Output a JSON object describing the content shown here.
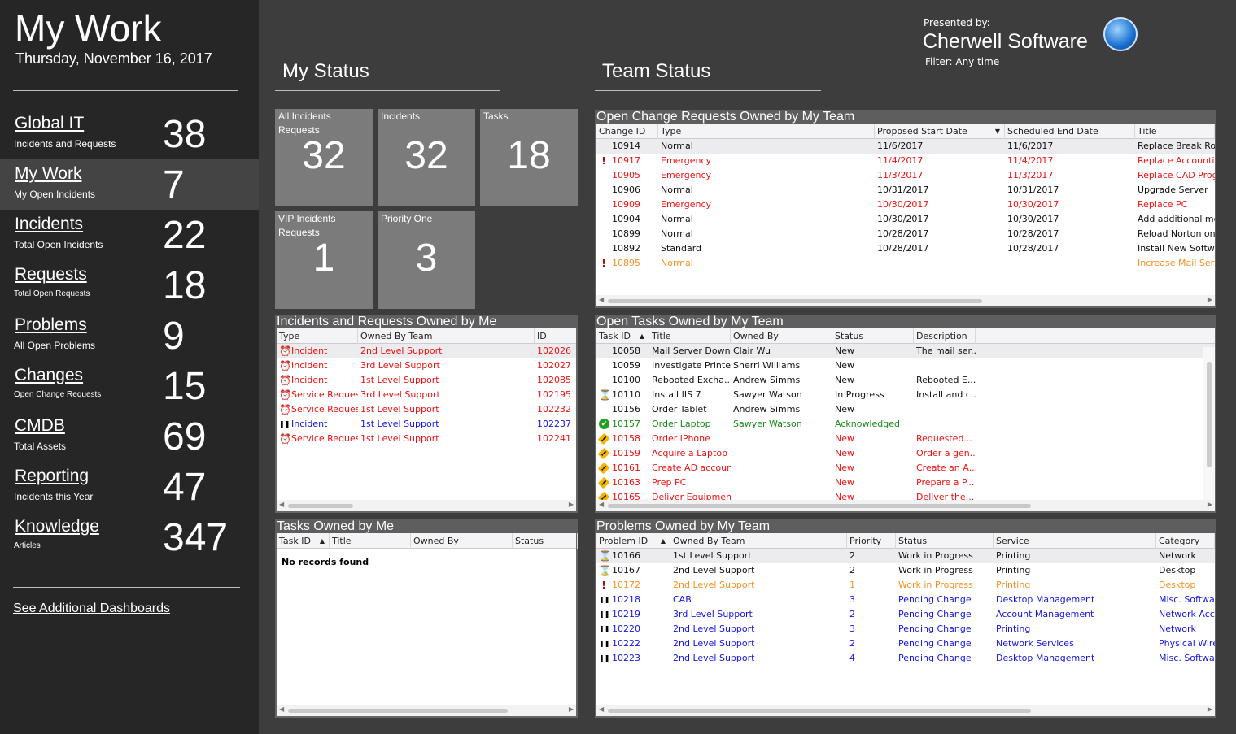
{
  "app": {
    "title": "My Work",
    "date": "Thursday, November 16, 2017"
  },
  "sidebar": {
    "items": [
      {
        "label": "Global IT",
        "sub": "Incidents and Requests",
        "count": "38"
      },
      {
        "label": "My Work",
        "sub": "My Open Incidents",
        "count": "7",
        "active": true
      },
      {
        "label": "Incidents",
        "sub": "Total Open Incidents",
        "count": "22"
      },
      {
        "label": "Requests",
        "sub": "Total Open Requests",
        "count": "18"
      },
      {
        "label": "Problems",
        "sub": "All Open Problems",
        "count": "9"
      },
      {
        "label": "Changes",
        "sub": "Open Change Requests",
        "count": "15"
      },
      {
        "label": "CMDB",
        "sub": "Total Assets",
        "count": "69"
      },
      {
        "label": "Reporting",
        "sub": "Incidents this Year",
        "count": "47"
      },
      {
        "label": "Knowledge",
        "sub": "Articles",
        "count": "347"
      }
    ],
    "see_more": "See Additional Dashboards"
  },
  "header": {
    "presented_by": "Presented by:",
    "company": "Cherwell Software",
    "filter": "Filter: Any time"
  },
  "my_status": {
    "title": "My Status",
    "tiles": [
      {
        "label": "All Incidents Requests",
        "value": "32"
      },
      {
        "label": "Incidents",
        "value": "32"
      },
      {
        "label": "Tasks",
        "value": "18"
      },
      {
        "label": "VIP Incidents Requests",
        "value": "1"
      },
      {
        "label": "Priority One",
        "value": "3"
      }
    ]
  },
  "team_status": {
    "title": "Team Status"
  },
  "colors": {
    "red": "#ee1111",
    "orange": "#f7901e",
    "blue": "#1414e6",
    "green": "#168a16",
    "black": "#111111"
  },
  "panels": {
    "change_requests": {
      "title": "Open Change Requests Owned by My Team",
      "columns": [
        "Change ID",
        "Type",
        "Proposed Start Date",
        "Scheduled End Date",
        "Title"
      ],
      "rows": [
        {
          "c": "black",
          "cells": [
            "10914",
            "Normal",
            "11/6/2017",
            "11/6/2017",
            "Replace Break Room"
          ]
        },
        {
          "c": "red",
          "i": "exclaim",
          "cells": [
            "10917",
            "Emergency",
            "11/4/2017",
            "11/4/2017",
            "Replace Accounting"
          ]
        },
        {
          "c": "red",
          "cells": [
            "10905",
            "Emergency",
            "11/3/2017",
            "11/3/2017",
            "Replace CAD Program"
          ]
        },
        {
          "c": "black",
          "cells": [
            "10906",
            "Normal",
            "10/31/2017",
            "10/31/2017",
            "Upgrade Server"
          ]
        },
        {
          "c": "red",
          "cells": [
            "10909",
            "Emergency",
            "10/30/2017",
            "10/30/2017",
            "Replace PC"
          ]
        },
        {
          "c": "black",
          "cells": [
            "10904",
            "Normal",
            "10/30/2017",
            "10/30/2017",
            "Add additional memory"
          ]
        },
        {
          "c": "black",
          "cells": [
            "10899",
            "Normal",
            "10/28/2017",
            "10/28/2017",
            "Reload Norton on Server"
          ]
        },
        {
          "c": "black",
          "cells": [
            "10892",
            "Standard",
            "10/28/2017",
            "10/28/2017",
            "Install New Software"
          ]
        },
        {
          "c": "orange",
          "i": "exclaim",
          "cells": [
            "10895",
            "Normal",
            "",
            "",
            "Increase Mail Server"
          ]
        }
      ]
    },
    "my_incidents": {
      "title": "Incidents and Requests Owned by Me",
      "columns": [
        "Type",
        "Owned By Team",
        "ID"
      ],
      "rows": [
        {
          "c": "red",
          "i": "clock",
          "cells": [
            "Incident",
            "2nd Level Support",
            "102026"
          ]
        },
        {
          "c": "red",
          "i": "clock",
          "cells": [
            "Incident",
            "3rd Level Support",
            "102027"
          ]
        },
        {
          "c": "red",
          "i": "clock",
          "cells": [
            "Incident",
            "1st Level Support",
            "102085"
          ]
        },
        {
          "c": "red",
          "i": "clock",
          "cells": [
            "Service Request",
            "3rd Level Support",
            "102195"
          ]
        },
        {
          "c": "red",
          "i": "clock",
          "cells": [
            "Service Request",
            "1st Level Support",
            "102232"
          ]
        },
        {
          "c": "blue",
          "i": "pause",
          "cells": [
            "Incident",
            "1st Level Support",
            "102237"
          ]
        },
        {
          "c": "red",
          "i": "clock",
          "cells": [
            "Service Request",
            "1st Level Support",
            "102241"
          ]
        }
      ]
    },
    "team_tasks": {
      "title": "Open Tasks Owned by My Team",
      "columns": [
        "Task ID",
        "Title",
        "Owned By",
        "Status",
        "Description"
      ],
      "rows": [
        {
          "c": "black",
          "cells": [
            "10058",
            "Mail Server Down",
            "Clair Wu",
            "New",
            "The mail ser..."
          ]
        },
        {
          "c": "black",
          "cells": [
            "10059",
            "Investigate Printer",
            "Sherri Williams",
            "New",
            ""
          ]
        },
        {
          "c": "black",
          "cells": [
            "10100",
            "Rebooted Excha...",
            "Andrew Simms",
            "New",
            "Rebooted E..."
          ]
        },
        {
          "c": "black",
          "i": "hourglass",
          "cells": [
            "10110",
            "Install IIS 7",
            "Sawyer Watson",
            "In Progress",
            "Install and c..."
          ]
        },
        {
          "c": "black",
          "cells": [
            "10156",
            "Order Tablet",
            "Andrew Simms",
            "New",
            ""
          ]
        },
        {
          "c": "green",
          "i": "check",
          "cells": [
            "10157",
            "Order Laptop",
            "Sawyer Watson",
            "Acknowledged",
            ""
          ]
        },
        {
          "c": "red",
          "i": "warn",
          "cells": [
            "10158",
            "Order iPhone",
            "",
            "New",
            "Requested..."
          ]
        },
        {
          "c": "red",
          "i": "warn",
          "cells": [
            "10159",
            "Acquire a Laptop",
            "",
            "New",
            "Order a gen..."
          ]
        },
        {
          "c": "red",
          "i": "warn",
          "cells": [
            "10161",
            "Create AD account",
            "",
            "New",
            "Create an A..."
          ]
        },
        {
          "c": "red",
          "i": "warn",
          "cells": [
            "10163",
            "Prep PC",
            "",
            "New",
            "Prepare a P..."
          ]
        },
        {
          "c": "red",
          "i": "warn",
          "cells": [
            "10165",
            "Deliver Equipment",
            "",
            "New",
            "Deliver the..."
          ]
        }
      ]
    },
    "my_tasks": {
      "title": "Tasks Owned by Me",
      "columns": [
        "Task ID",
        "Title",
        "Owned By",
        "Status"
      ],
      "empty": "No records found",
      "rows": []
    },
    "team_problems": {
      "title": "Problems Owned by My Team",
      "columns": [
        "Problem ID",
        "Owned By Team",
        "Priority",
        "Status",
        "Service",
        "Category"
      ],
      "rows": [
        {
          "c": "black",
          "i": "hourglass",
          "cells": [
            "10166",
            "1st Level Support",
            "2",
            "Work in Progress",
            "Printing",
            "Network"
          ]
        },
        {
          "c": "black",
          "i": "hourglass",
          "cells": [
            "10167",
            "2nd Level Support",
            "2",
            "Work in Progress",
            "Printing",
            "Desktop"
          ]
        },
        {
          "c": "orange",
          "i": "exclaim",
          "cells": [
            "10172",
            "2nd Level Support",
            "1",
            "Work in Progress",
            "Printing",
            "Desktop"
          ]
        },
        {
          "c": "blue",
          "i": "pause",
          "cells": [
            "10218",
            "CAB",
            "3",
            "Pending Change",
            "Desktop Management",
            "Misc. Software"
          ]
        },
        {
          "c": "blue",
          "i": "pause",
          "cells": [
            "10219",
            "3rd Level Support",
            "2",
            "Pending Change",
            "Account Management",
            "Network Access"
          ]
        },
        {
          "c": "blue",
          "i": "pause",
          "cells": [
            "10220",
            "2nd Level Support",
            "3",
            "Pending Change",
            "Printing",
            "Network"
          ]
        },
        {
          "c": "blue",
          "i": "pause",
          "cells": [
            "10222",
            "2nd Level Support",
            "2",
            "Pending Change",
            "Network Services",
            "Physical Wires"
          ]
        },
        {
          "c": "blue",
          "i": "pause",
          "cells": [
            "10223",
            "2nd Level Support",
            "4",
            "Pending Change",
            "Desktop Management",
            "Misc. Software"
          ]
        }
      ]
    }
  }
}
